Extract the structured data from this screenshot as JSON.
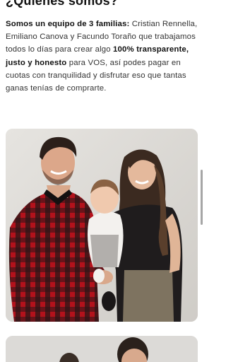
{
  "section": {
    "heading": "¿Quiénes somos?"
  },
  "about": {
    "p1_bold": "Somos un equipo de 3 familias:",
    "p1_text": " Cristian Rennella, Emiliano Canova y Facundo Toraño que trabajamos todos lo días para crear algo ",
    "p2_bold": "100% transparente, justo y honesto",
    "p2_text": " para VOS, así podes pagar en cuotas con tranquilidad y disfrutar eso que tantas ganas tenías de comprarte."
  },
  "colors": {
    "plaid_red": "#b3121c",
    "plaid_dark": "#1b1416",
    "background": "#ffffff",
    "card_bg": "#dedcd8"
  }
}
